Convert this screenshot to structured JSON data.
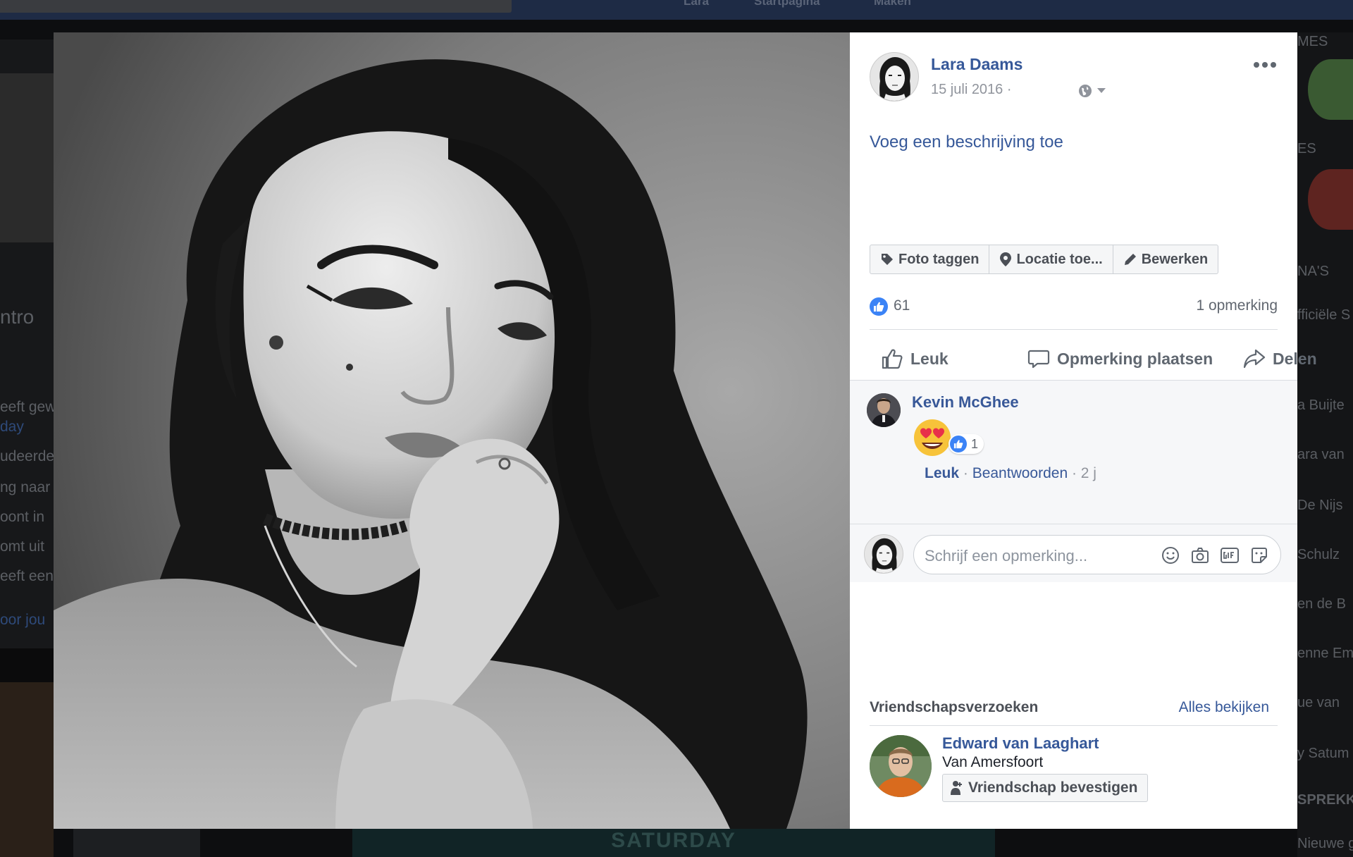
{
  "background": {
    "nav_links": [
      "Lara",
      "Startpagina",
      "Maken"
    ],
    "left_snippets": [
      "ntro",
      "eeft gew",
      "day",
      "udeerde",
      "ng naar",
      "oont in",
      "omt uit",
      "eeft een",
      "oor jou"
    ],
    "right_snippets": [
      "MES",
      "ES",
      "NA'S",
      "fficiële S",
      "a Buijte",
      "ara van",
      "De Nijs",
      "Schulz",
      "en de B",
      "enne Em",
      "ue van",
      "y Satum",
      "SPREKKI",
      "Nieuwe gro"
    ],
    "bottom_banner": "SATURDAY"
  },
  "post": {
    "author": "Lara Daams",
    "date": "15 juli 2016 ·",
    "description_prompt": "Voeg een beschrijving toe",
    "tools": {
      "tag": "Foto taggen",
      "location": "Locatie toe...",
      "edit": "Bewerken"
    },
    "like_count": "61",
    "comment_count": "1 opmerking",
    "actions": {
      "like": "Leuk",
      "comment": "Opmerking plaatsen",
      "share": "Delen"
    }
  },
  "comment": {
    "author": "Kevin McGhee",
    "emoji": "heart-eyes-emoji",
    "like_count": "1",
    "like": "Leuk",
    "sep1": " · ",
    "reply": "Beantwoorden",
    "time": " · 2 j"
  },
  "reply_box": {
    "placeholder": "Schrijf een opmerking..."
  },
  "friend_requests": {
    "title": "Vriendschapsverzoeken",
    "see_all": "Alles bekijken",
    "request": {
      "name": "Edward van Laaghart",
      "city": "Van Amersfoort",
      "confirm": "Vriendschap bevestigen"
    }
  },
  "colors": {
    "link": "#365899",
    "like_blue": "#3b83f6",
    "muted": "#90949c"
  }
}
